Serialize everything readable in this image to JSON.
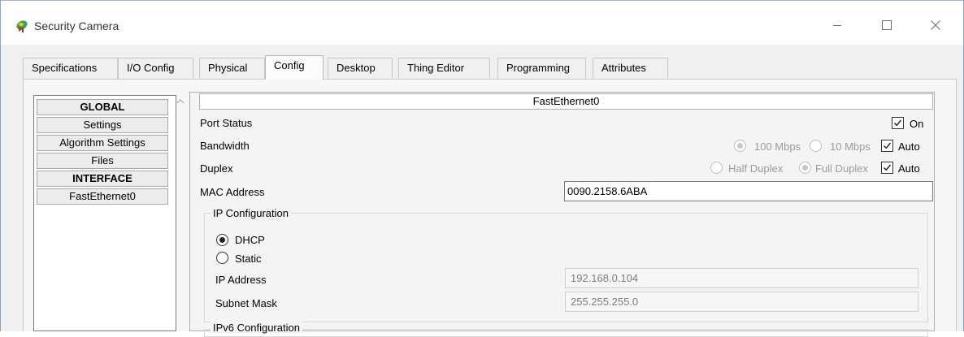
{
  "window": {
    "title": "Security Camera",
    "controls": {
      "minimize_icon": "minimize-icon",
      "maximize_icon": "maximize-icon",
      "close_icon": "close-icon"
    }
  },
  "tabs": [
    {
      "label": "Specifications",
      "active": false
    },
    {
      "label": "I/O Config",
      "active": false
    },
    {
      "label": "Physical",
      "active": false
    },
    {
      "label": "Config",
      "active": true
    },
    {
      "label": "Desktop",
      "active": false
    },
    {
      "label": "Thing Editor",
      "active": false
    },
    {
      "label": "Programming",
      "active": false
    },
    {
      "label": "Attributes",
      "active": false
    }
  ],
  "sidebar": {
    "items": [
      {
        "label": "GLOBAL",
        "type": "header"
      },
      {
        "label": "Settings",
        "type": "item"
      },
      {
        "label": "Algorithm Settings",
        "type": "item"
      },
      {
        "label": "Files",
        "type": "item"
      },
      {
        "label": "INTERFACE",
        "type": "header"
      },
      {
        "label": "FastEthernet0",
        "type": "item"
      }
    ]
  },
  "interface": {
    "header": "FastEthernet0",
    "port_status": {
      "label": "Port Status",
      "on_label": "On",
      "on_checked": true
    },
    "bandwidth": {
      "label": "Bandwidth",
      "option_100": "100 Mbps",
      "option_10": "10 Mbps",
      "selected": "100 Mbps",
      "auto_label": "Auto",
      "auto_checked": true
    },
    "duplex": {
      "label": "Duplex",
      "option_half": "Half Duplex",
      "option_full": "Full Duplex",
      "selected": "Full Duplex",
      "auto_label": "Auto",
      "auto_checked": true
    },
    "mac_address": {
      "label": "MAC Address",
      "value": "0090.2158.6ABA"
    },
    "ip_config": {
      "title": "IP Configuration",
      "dhcp_label": "DHCP",
      "static_label": "Static",
      "mode": "DHCP",
      "ip_address_label": "IP Address",
      "ip_address": "192.168.0.104",
      "subnet_mask_label": "Subnet Mask",
      "subnet_mask": "255.255.255.0"
    },
    "ipv6_config": {
      "title": "IPv6 Configuration"
    }
  }
}
